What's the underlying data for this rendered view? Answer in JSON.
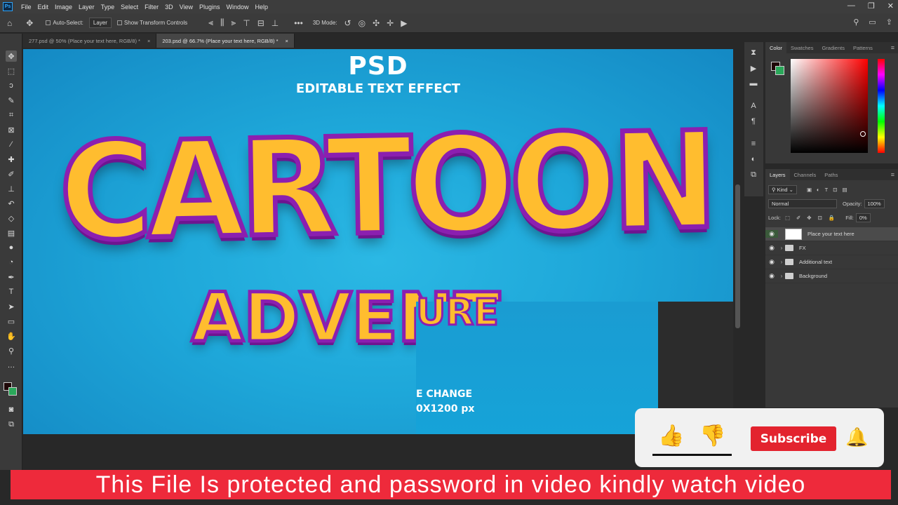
{
  "app": {
    "logo": "Ps"
  },
  "menu": [
    "File",
    "Edit",
    "Image",
    "Layer",
    "Type",
    "Select",
    "Filter",
    "3D",
    "View",
    "Plugins",
    "Window",
    "Help"
  ],
  "options": {
    "auto_select": "Auto-Select:",
    "auto_select_value": "Layer",
    "transform_controls": "Show Transform Controls",
    "mode_3d": "3D Mode:",
    "more": "•••"
  },
  "tabs": [
    {
      "label": "277.psd @ 50% (Place your text here, RGB/8) *",
      "close": "×"
    },
    {
      "label": "203.psd @ 66.7% (Place your text here, RGB/8) *",
      "close": "×"
    }
  ],
  "canvas": {
    "psd": "PSD",
    "subtitle": "EDITABLE TEXT EFFECT",
    "line1": "CARTOON",
    "line2": "ADVENT",
    "line3": "URE",
    "info1": "E CHANGE",
    "info2": "0X1200 px"
  },
  "color_panel": {
    "tabs": [
      "Color",
      "Swatches",
      "Gradients",
      "Patterns"
    ],
    "fg": "#1f0808",
    "bg": "#2aa85a"
  },
  "layers_panel": {
    "tabs": [
      "Layers",
      "Channels",
      "Paths"
    ],
    "kind": "Kind",
    "blend": "Normal",
    "opacity_label": "Opacity:",
    "opacity": "100%",
    "lock_label": "Lock:",
    "fill_label": "Fill:",
    "fill": "0%",
    "layers": [
      {
        "name": "Place your text here",
        "type": "smart-object"
      },
      {
        "name": "FX",
        "type": "group"
      },
      {
        "name": "Additional text",
        "type": "group"
      },
      {
        "name": "Background",
        "type": "group"
      }
    ]
  },
  "overlay": {
    "subscribe": "Subscribe",
    "banner": "This File Is protected and password in video kindly watch video"
  }
}
